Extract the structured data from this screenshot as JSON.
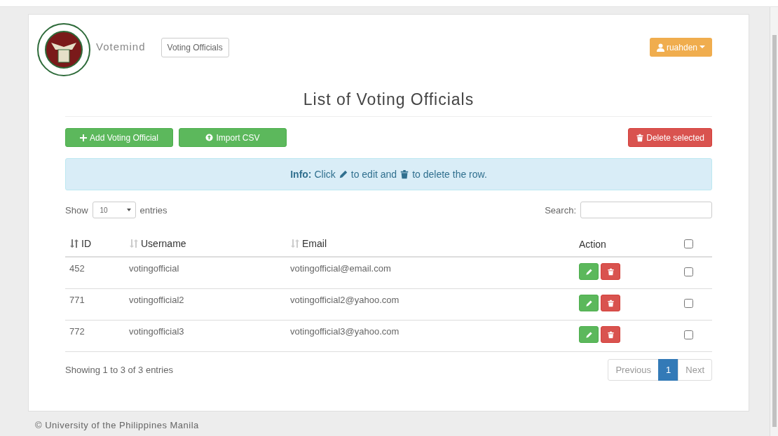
{
  "brand": "Votemind",
  "nav": [
    {
      "label": "Voting Officials"
    }
  ],
  "user": {
    "name": "ruahden"
  },
  "title": "List of Voting Officials",
  "actions": [
    {
      "label": "Add Voting Official",
      "kind": "add"
    },
    {
      "label": "Import CSV",
      "kind": "import"
    }
  ],
  "delete_button": "Delete selected",
  "info": {
    "label": "Info:",
    "before": "Click",
    "middle": "to edit and",
    "after": "to delete the row."
  },
  "length": {
    "before": "Show",
    "value": "10",
    "after": "entries"
  },
  "search": {
    "label": "Search:"
  },
  "table": {
    "columns": [
      {
        "label": "ID",
        "kind": "sortable",
        "sorted": true
      },
      {
        "label": "Username",
        "kind": "sortable",
        "sorted": false
      },
      {
        "label": "Email",
        "kind": "sortable",
        "sorted": false
      },
      {
        "label": "Action",
        "kind": "plain"
      },
      {
        "kind": "checkbox",
        "checked": false
      }
    ],
    "rows": [
      {
        "id": "452",
        "username": "votingofficial",
        "email": "votingofficial@email.com",
        "checked": false
      },
      {
        "id": "771",
        "username": "votingofficial2",
        "email": "votingofficial2@yahoo.com",
        "checked": false
      },
      {
        "id": "772",
        "username": "votingofficial3",
        "email": "votingofficial3@yahoo.com",
        "checked": false
      }
    ]
  },
  "summary": "Showing 1 to 3 of 3 entries",
  "pagination": {
    "previous": {
      "label": "Previous",
      "disabled": true
    },
    "pages": [
      {
        "label": "1",
        "selected": true
      }
    ],
    "next": {
      "label": "Next",
      "disabled": true
    }
  },
  "footer": "© University of the Philippines Manila"
}
